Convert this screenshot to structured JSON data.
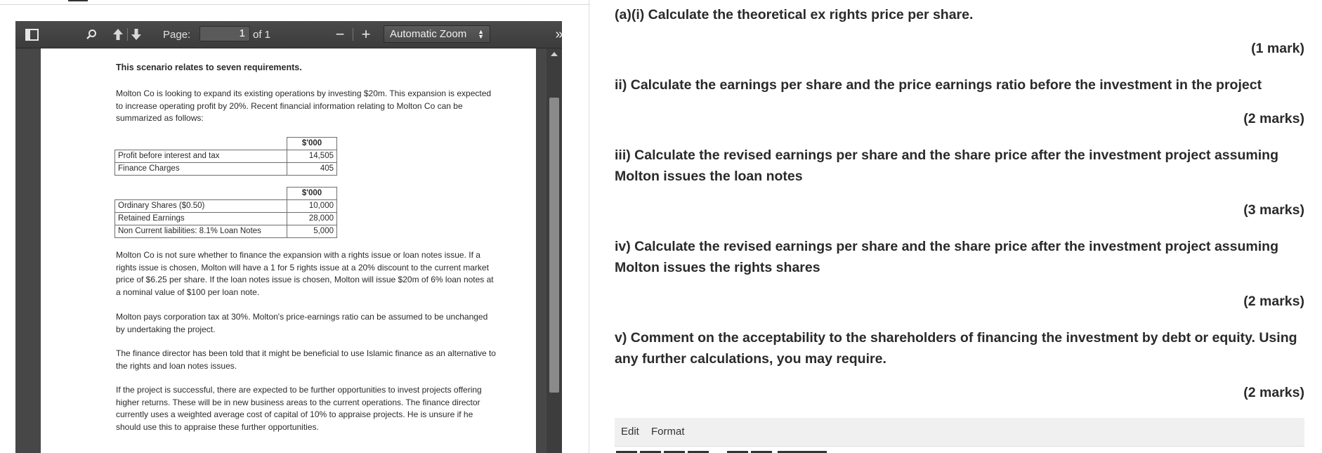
{
  "viewer": {
    "toolbar": {
      "page_label": "Page:",
      "page_value": "1",
      "page_of": "of 1",
      "zoom_out": "−",
      "zoom_in": "+",
      "zoom_value": "Automatic Zoom",
      "tools_glyph": "»",
      "icons": [
        "sidebar-toggle-icon",
        "search-icon",
        "arrow-up-icon",
        "arrow-down-icon",
        "chevron-double-right-icon"
      ]
    },
    "document": {
      "heading": "This scenario relates to seven requirements.",
      "intro": "Molton Co is looking to expand its existing operations by investing $20m. This expansion is expected to increase operating profit by 20%. Recent financial information relating to Molton Co can be summarized as follows:",
      "table1": {
        "header": "$'000",
        "rows": [
          {
            "label": "Profit before interest and tax",
            "value": "14,505"
          },
          {
            "label": "Finance Charges",
            "value": "405"
          }
        ]
      },
      "table2": {
        "header": "$'000",
        "rows": [
          {
            "label": "Ordinary Shares ($0.50)",
            "value": "10,000"
          },
          {
            "label": "Retained Earnings",
            "value": "28,000"
          },
          {
            "label": "Non Current liabilities: 8.1% Loan Notes",
            "value": "5,000"
          }
        ]
      },
      "para_finance": "Molton Co is not sure whether to finance the expansion with a rights issue or loan notes issue. If a rights issue is chosen, Molton will have a 1 for 5 rights issue at a 20% discount to the current market price of $6.25 per share. If the loan notes issue is chosen, Molton will issue $20m of 6% loan notes at a nominal value of $100 per loan note.",
      "para_tax": "Molton pays corporation tax at 30%. Molton's price-earnings ratio can be assumed to be unchanged by undertaking the project.",
      "para_islamic": "The finance director has been told that it might be beneficial to use Islamic finance as an alternative to the rights and loan notes issues.",
      "para_future": "If the project is successful, there are expected to be further opportunities to invest projects offering higher returns. These will be in new business areas to the current operations. The finance director currently uses a weighted average cost of capital of 10% to appraise projects. He is unsure if he should use this to appraise these further opportunities."
    }
  },
  "questions": [
    {
      "text": "(a)(i) Calculate the theoretical ex rights price per share.",
      "marks": "(1 mark)"
    },
    {
      "text": "ii) Calculate the earnings per share and the price earnings ratio before the investment in the project",
      "marks": "(2 marks)"
    },
    {
      "text": "iii) Calculate the revised earnings per share and the share price after the investment project assuming Molton issues the loan notes",
      "marks": "(3 marks)"
    },
    {
      "text": "iv) Calculate the revised earnings per share and the share price after the investment project assuming Molton issues the rights shares",
      "marks": "(2 marks)"
    },
    {
      "text": "v) Comment on the acceptability to the shareholders of financing the investment by debt or equity. Using any further calculations, you may require.",
      "marks": "(2 marks)"
    }
  ],
  "editor": {
    "menu": [
      "Edit",
      "Format"
    ]
  }
}
